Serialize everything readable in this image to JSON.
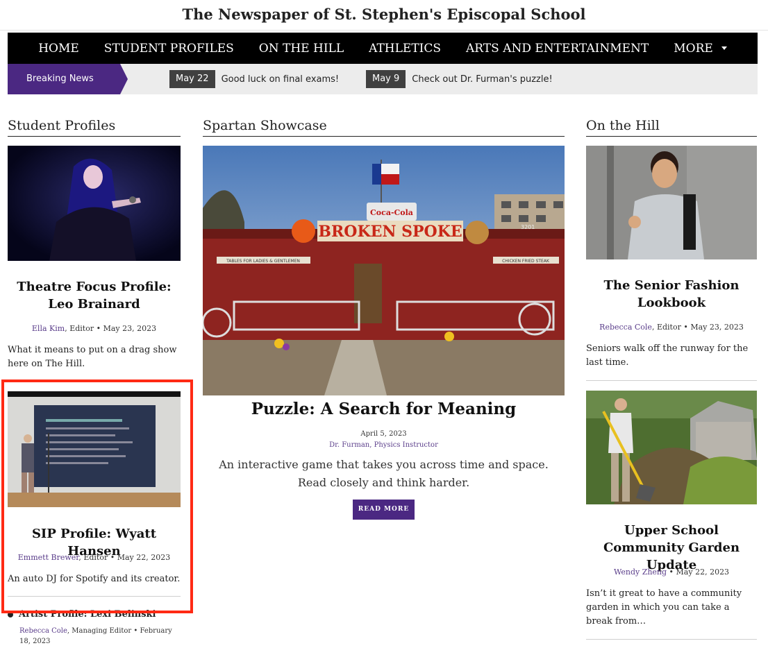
{
  "site": {
    "title": "The Newspaper of St. Stephen's Episcopal School"
  },
  "nav": {
    "items": [
      "HOME",
      "STUDENT PROFILES",
      "ON THE HILL",
      "ATHLETICS",
      "ARTS AND ENTERTAINMENT"
    ],
    "more_label": "MORE"
  },
  "breaking": {
    "label": "Breaking News",
    "items": [
      {
        "date": "May 22",
        "text": "Good luck on final exams!"
      },
      {
        "date": "May 9",
        "text": "Check out Dr. Furman's puzzle!"
      }
    ]
  },
  "colors": {
    "accent": "#4b2882",
    "nav_bg": "#000000",
    "highlight": "#ff2a14"
  },
  "left": {
    "heading": "Student Profiles",
    "articles": [
      {
        "title": "Theatre Focus Profile: Leo Brainard",
        "author": "Ella Kim",
        "meta": ", Editor • May 23, 2023",
        "excerpt": "What it means to put on a drag show here on The Hill."
      },
      {
        "title": "SIP Profile: Wyatt Hansen",
        "author": "Emmett Brewer",
        "meta": ", Editor • May 22, 2023",
        "excerpt": "An auto DJ for Spotify and its creator."
      }
    ],
    "list_item": {
      "title": "Artist Profile: Lexi Belinski",
      "author": "Rebecca Cole",
      "meta": ", Managing Editor • February 18, 2023"
    }
  },
  "center": {
    "heading": "Spartan Showcase",
    "image_sign": "BROKEN SPOKE",
    "image_brand": "Coca-Cola",
    "image_number": "3201",
    "image_banner_left": "TABLES FOR LADIES & GENTLEMEN",
    "image_banner_right": "CHICKEN FRIED STEAK",
    "title": "Puzzle: A Search for Meaning",
    "date": "April 5, 2023",
    "author": "Dr. Furman",
    "role": ", Physics Instructor",
    "excerpt": "An interactive game that takes you across time and space. Read closely and think harder.",
    "read_more": "READ MORE"
  },
  "right": {
    "heading": "On the Hill",
    "articles": [
      {
        "title": "The Senior Fashion Lookbook",
        "author": "Rebecca Cole",
        "meta": ", Editor • May 23, 2023",
        "excerpt": "Seniors walk off the runway for the last time."
      },
      {
        "title": "Upper School Community Garden Update",
        "author": "Wendy Zheng",
        "meta": " • May 22, 2023",
        "excerpt": "Isn’t it great to have a community garden in which you can take a break from…"
      }
    ]
  }
}
